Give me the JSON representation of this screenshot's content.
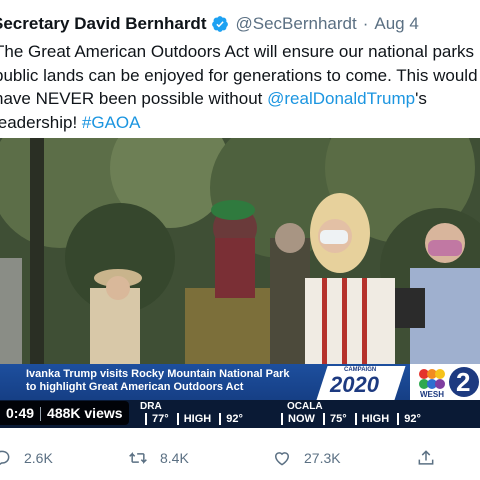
{
  "tweet": {
    "display_name": "Secretary David Bernhardt",
    "handle": "@SecBernhardt",
    "separator": "·",
    "date": "Aug 4",
    "body_lines": [
      "The Great American Outdoors Act will ensure our national parks",
      "public lands can be enjoyed for generations to come. This would",
      "have NEVER been possible without"
    ],
    "mention": "@realDonaldTrump",
    "after_mention": "'s",
    "last_line_prefix": "leadership!",
    "hashtag": "#GAOA"
  },
  "video": {
    "lower_third_line1": "Ivanka Trump visits Rocky Mountain National Park",
    "lower_third_line2": "to highlight Great American Outdoors Act",
    "logo_2020_small": "CAMPAIGN",
    "logo_2020": "2020",
    "station": "WESH 2",
    "ticker_top": [
      "DRA",
      "OCALA"
    ],
    "ticker_bottom": [
      "77°",
      "HIGH",
      "92°",
      "NOW",
      "75°",
      "HIGH",
      "92°"
    ],
    "elapsed": "0:49",
    "views": "488K views"
  },
  "actions": {
    "replies": "2.6K",
    "retweets": "8.4K",
    "likes": "27.3K"
  },
  "colors": {
    "link": "#1b95e0",
    "verified": "#1da1f2",
    "muted": "#5b7083",
    "news_blue": "#1d4f9e"
  }
}
